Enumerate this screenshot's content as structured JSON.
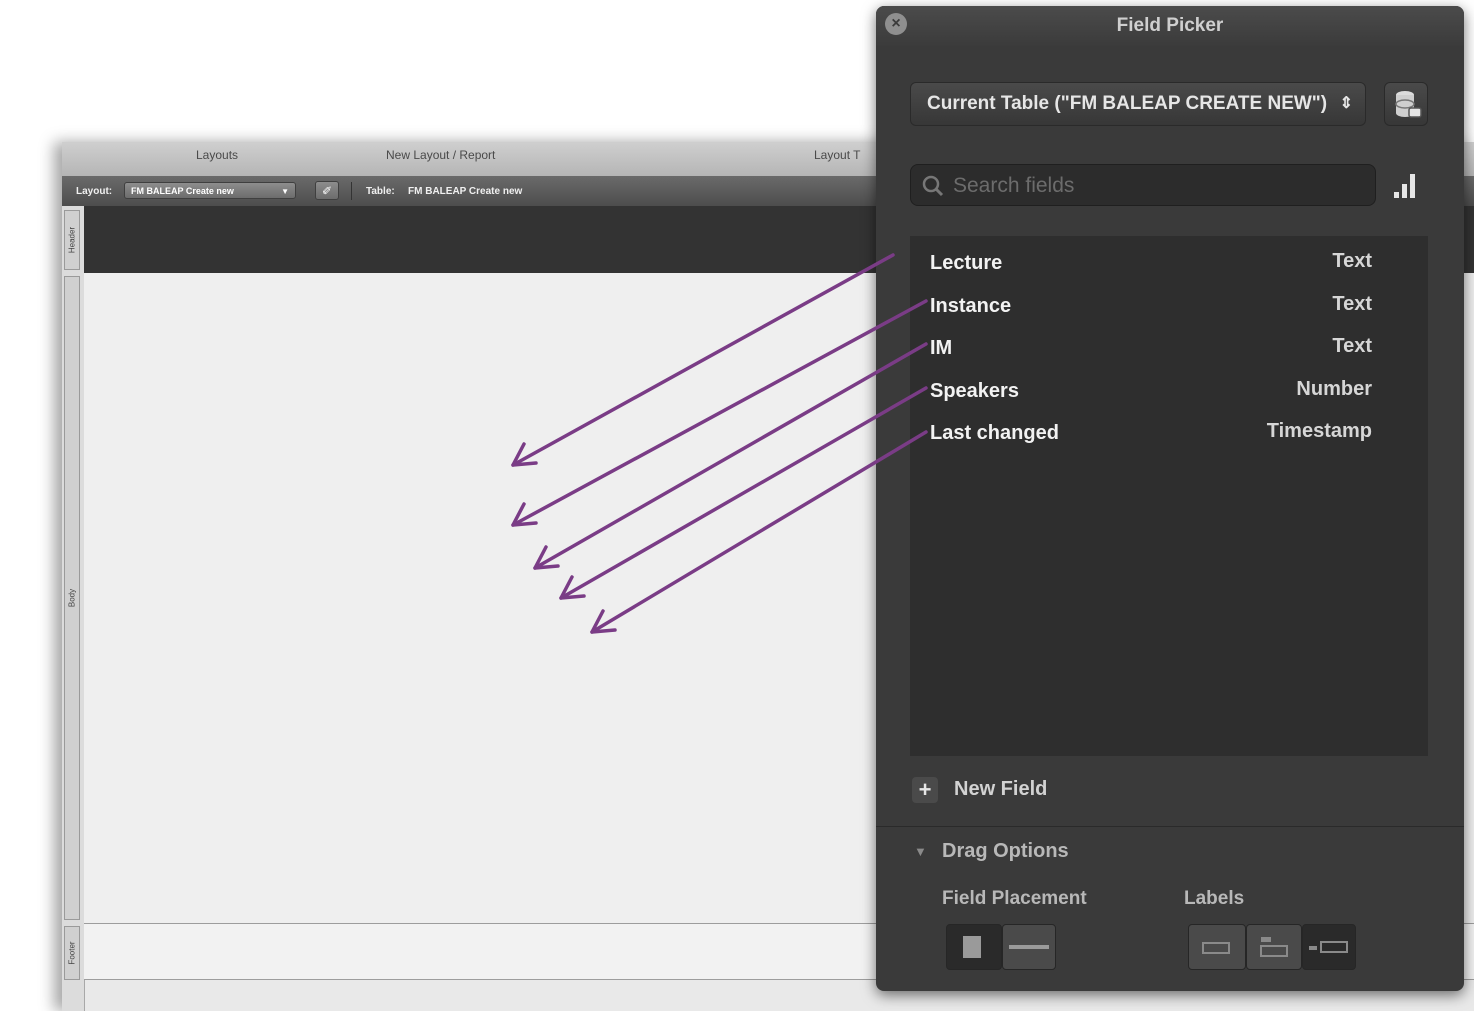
{
  "layout_window": {
    "toolbar": {
      "layouts_label": "Layouts",
      "new_layout_label": "New Layout / Report",
      "layout_tools_label": "Layout T"
    },
    "layout_bar": {
      "layout_label": "Layout:",
      "layout_value": "FM BALEAP Create new",
      "table_label": "Table:",
      "table_value": "FM BALEAP Create new"
    },
    "parts": {
      "header": "Header",
      "body": "Body",
      "footer": "Footer"
    }
  },
  "field_picker": {
    "title": "Field Picker",
    "table_select": "Current Table (\"FM BALEAP CREATE NEW\")",
    "search_placeholder": "Search fields",
    "fields": [
      {
        "name": "Lecture",
        "type": "Text"
      },
      {
        "name": "Instance",
        "type": "Text"
      },
      {
        "name": "IM",
        "type": "Text"
      },
      {
        "name": "Speakers",
        "type": "Number"
      },
      {
        "name": "Last changed",
        "type": "Timestamp"
      }
    ],
    "new_field_label": "New Field",
    "drag_options_label": "Drag Options",
    "field_placement_label": "Field Placement",
    "labels_label": "Labels"
  },
  "colors": {
    "arrow": "#7a3c86",
    "panel": "#3a3a3a"
  }
}
